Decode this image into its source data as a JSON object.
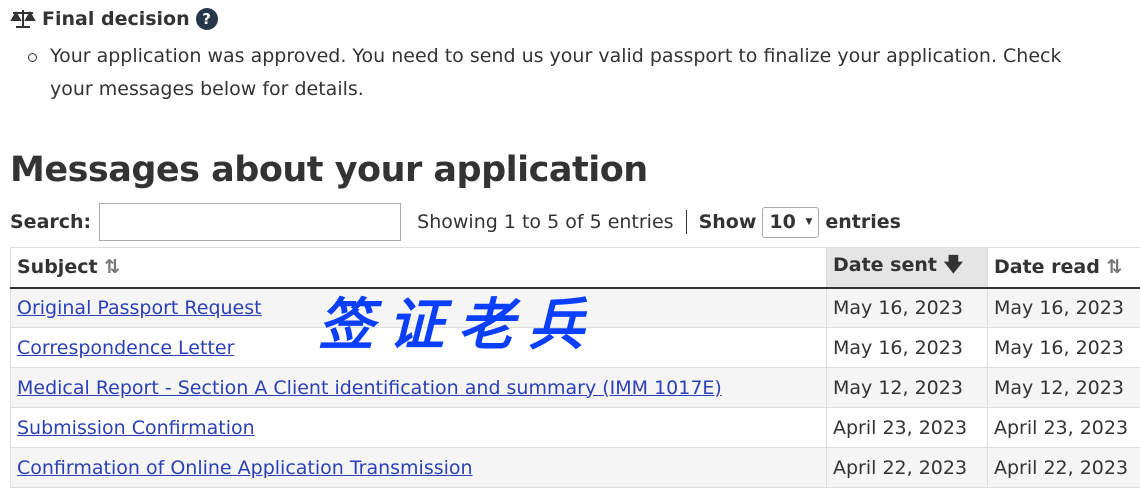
{
  "decision": {
    "title": "Final decision",
    "icon": "scales-icon",
    "help_icon": "?",
    "text": "Your application was approved. You need to send us your valid passport to finalize your application. Check your messages below for details."
  },
  "messages": {
    "title": "Messages about your application",
    "search_label": "Search:",
    "search_value": "",
    "showing": "Showing 1 to 5 of 5 entries",
    "show_label": "Show",
    "page_size": "10",
    "entries_label": "entries",
    "columns": [
      "Subject",
      "Date sent",
      "Date read"
    ],
    "sorted_column": "Date sent",
    "sort_direction": "descending",
    "rows": [
      {
        "subject": "Original Passport Request",
        "sent": "May 16, 2023",
        "read": "May 16, 2023"
      },
      {
        "subject": "Correspondence Letter",
        "sent": "May 16, 2023",
        "read": "May 16, 2023"
      },
      {
        "subject": "Medical Report - Section A Client identification and summary (IMM 1017E)",
        "sent": "May 12, 2023",
        "read": "May 12, 2023"
      },
      {
        "subject": "Submission Confirmation",
        "sent": "April 23, 2023",
        "read": "April 23, 2023"
      },
      {
        "subject": "Confirmation of Online Application Transmission",
        "sent": "April 22, 2023",
        "read": "April 22, 2023"
      }
    ]
  },
  "watermark": "签证老兵",
  "colors": {
    "link": "#2b3fb8",
    "help": "#26374a",
    "watermark": "#0a3fff"
  }
}
